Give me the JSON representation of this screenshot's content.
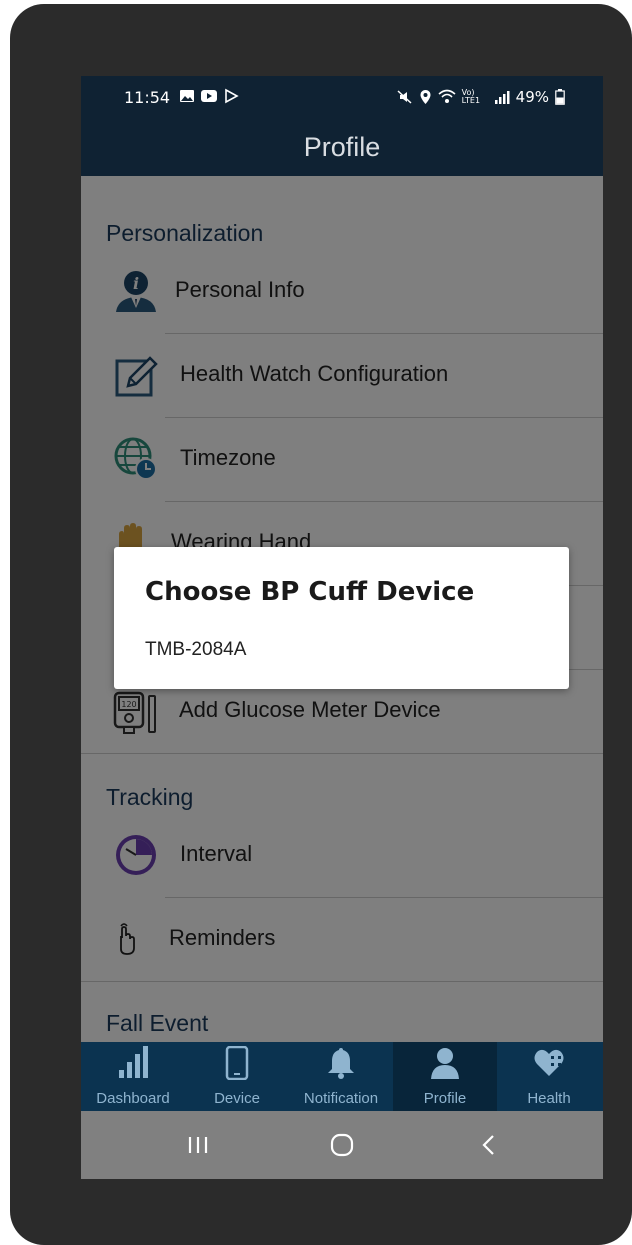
{
  "status_bar": {
    "time": "11:54",
    "battery": "49%",
    "network": "Vo) LTE1"
  },
  "header": {
    "title": "Profile"
  },
  "sections": {
    "personalization": "Personalization",
    "tracking": "Tracking",
    "fall_event": "Fall Event"
  },
  "items": {
    "personal_info": "Personal Info",
    "health_watch_config": "Health Watch Configuration",
    "timezone": "Timezone",
    "wearing_hand": "Wearing Hand",
    "add_glucose": "Add Glucose Meter Device",
    "interval": "Interval",
    "reminders": "Reminders",
    "glucose_icon_text": "120"
  },
  "dialog": {
    "title": "Choose BP Cuff Device",
    "option": "TMB-2084A"
  },
  "tabs": {
    "dashboard": "Dashboard",
    "device": "Device",
    "notification": "Notification",
    "profile": "Profile",
    "health": "Health"
  },
  "colors": {
    "header_bg": "#0f2233",
    "tab_bg": "#0b3350",
    "tab_active_bg": "#08253a",
    "section_text": "#1a3a5c"
  }
}
